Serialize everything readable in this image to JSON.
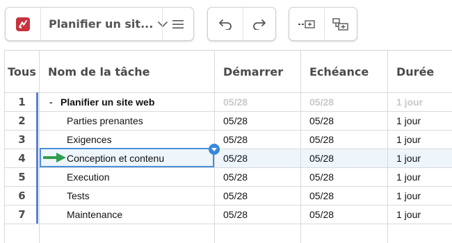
{
  "toolbar": {
    "app_icon": "app-logo-icon",
    "project_title": "Planifier un sit...",
    "title_dropdown_icon": "chevron-down-icon",
    "menu_icon": "hamburger-menu-icon",
    "undo_icon": "undo-icon",
    "redo_icon": "redo-icon",
    "outdent_icon": "outdent-task-icon",
    "indent_icon": "indent-task-icon"
  },
  "columns": {
    "all": "Tous",
    "name": "Nom de la tâche",
    "start": "Démarrer",
    "due": "Echéance",
    "duration": "Durée"
  },
  "rows": [
    {
      "num": "1",
      "name": "Planifier un site web",
      "start": "05/28",
      "due": "05/28",
      "duration": "1 jour",
      "collapse": "-"
    },
    {
      "num": "2",
      "name": "Parties prenantes",
      "start": "05/28",
      "due": "05/28",
      "duration": "1 jour"
    },
    {
      "num": "3",
      "name": "Exigences",
      "start": "05/28",
      "due": "05/28",
      "duration": "1 jour"
    },
    {
      "num": "4",
      "name": "Conception et contenu",
      "start": "05/28",
      "due": "05/28",
      "duration": "1 jour"
    },
    {
      "num": "5",
      "name": "Execution",
      "start": "05/28",
      "due": "05/28",
      "duration": "1 jour"
    },
    {
      "num": "6",
      "name": "Tests",
      "start": "05/28",
      "due": "05/28",
      "duration": "1 jour"
    },
    {
      "num": "7",
      "name": "Maintenance",
      "start": "05/28",
      "due": "05/28",
      "duration": "1 jour"
    }
  ],
  "selected_row": "4",
  "pointer_icon": "green-arrow-icon",
  "cell_dropdown_icon": "cell-dropdown-icon",
  "colors": {
    "app_icon_bg": "#c8323c",
    "accent_blue": "#4a90d9",
    "selection_bar": "#5b7fd6",
    "highlight_row": "#eef5fb",
    "arrow_green": "#2e9e4f"
  }
}
